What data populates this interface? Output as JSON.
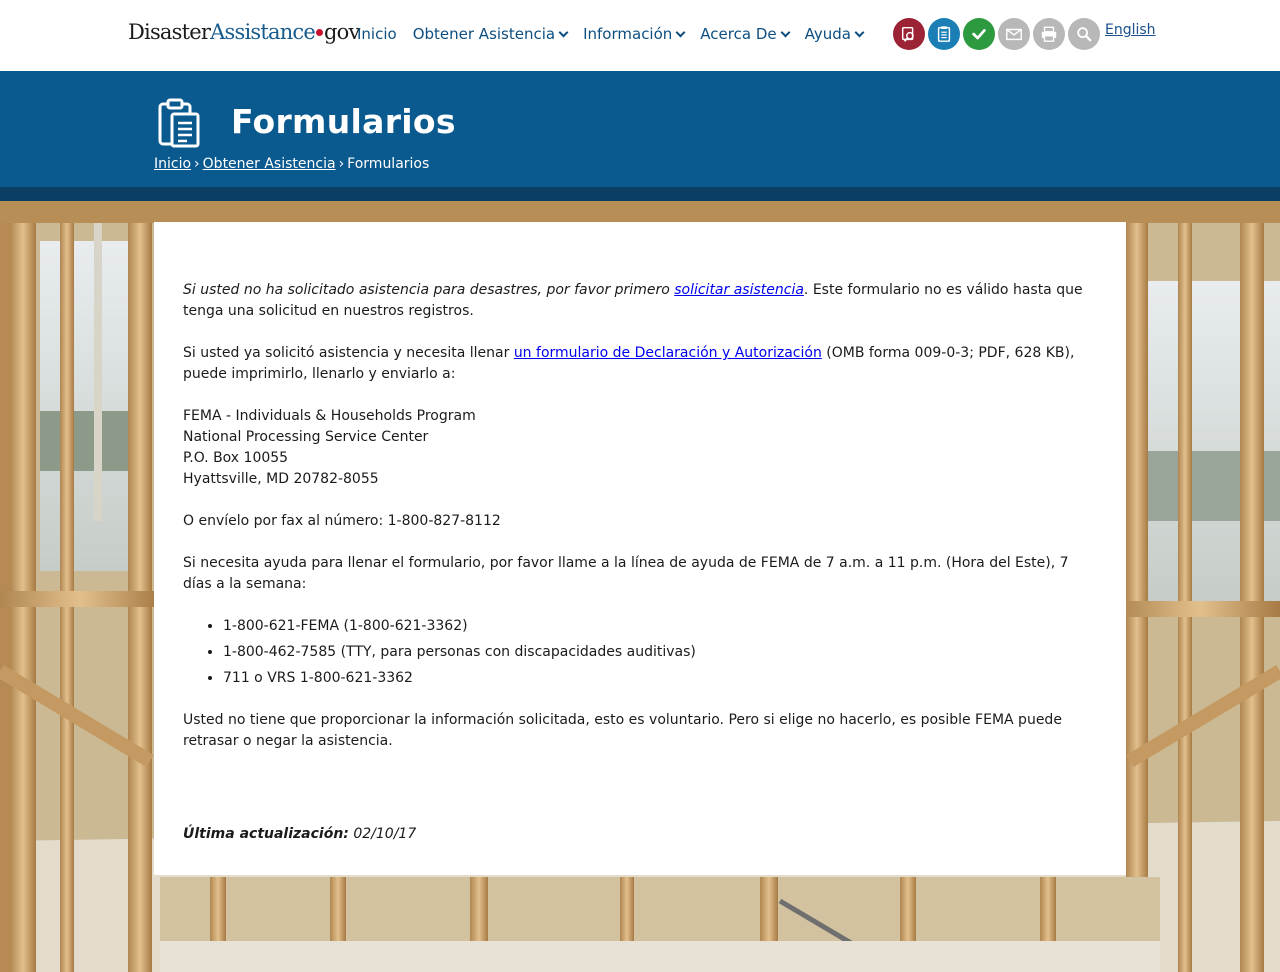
{
  "header": {
    "logo": {
      "part1": "Disaster",
      "part2": "Assistance",
      "part3": "gov"
    },
    "nav": [
      {
        "label": "Inicio",
        "has_dropdown": false
      },
      {
        "label": "Obtener Asistencia",
        "has_dropdown": true
      },
      {
        "label": "Información",
        "has_dropdown": true
      },
      {
        "label": "Acerca De",
        "has_dropdown": true
      },
      {
        "label": "Ayuda",
        "has_dropdown": true
      }
    ],
    "tool_icons": [
      {
        "name": "search-apply-icon",
        "color": "#9b2335"
      },
      {
        "name": "checklist-icon",
        "color": "#1b7fb5"
      },
      {
        "name": "check-icon",
        "color": "#2e9a3f"
      },
      {
        "name": "mail-icon",
        "color": "#b8b8b8"
      },
      {
        "name": "print-icon",
        "color": "#b8b8b8"
      },
      {
        "name": "search-icon",
        "color": "#b8b8b8"
      }
    ],
    "language_link": "English"
  },
  "banner": {
    "title": "Formularios",
    "breadcrumb": {
      "home": "Inicio",
      "separator": "›",
      "parent": "Obtener Asistencia",
      "current": "Formularios"
    },
    "colors": {
      "band": "#0a5a8f",
      "strip": "#0a3f63"
    }
  },
  "content": {
    "p1_italic": "Si usted no ha solicitado asistencia para desastres, por favor primero ",
    "p1_link": "solicitar asistencia",
    "p1_rest": ". Este formulario no es válido hasta que tenga una solicitud en nuestros registros.",
    "p2_start": "Si usted ya solicitó asistencia y necesita llenar ",
    "p2_link": "un formulario de Declaración y Autorización",
    "p2_rest": " (OMB forma 009-0-3; PDF, 628 KB), puede imprimirlo, llenarlo y enviarlo a:",
    "address": [
      "FEMA - Individuals & Households Program",
      "National Processing Service Center",
      "P.O. Box 10055",
      "Hyattsville, MD 20782-8055"
    ],
    "fax": "O envíelo por fax al número: 1-800-827-8112",
    "help": "Si necesita ayuda para llenar el formulario, por favor llame a la línea de ayuda de FEMA de 7 a.m. a 11 p.m. (Hora del Este), 7 días a la semana:",
    "phones": [
      "1-800-621-FEMA (1-800-621-3362)",
      "1-800-462-7585 (TTY, para personas con discapacidades auditivas)",
      "711 o VRS 1-800-621-3362"
    ],
    "voluntary": "Usted no tiene que proporcionar la información solicitada, esto es voluntario. Pero si elige no hacerlo, es posible FEMA puede retrasar o negar la asistencia.",
    "updated_label": "Última actualización:",
    "updated_date": "02/10/17"
  }
}
